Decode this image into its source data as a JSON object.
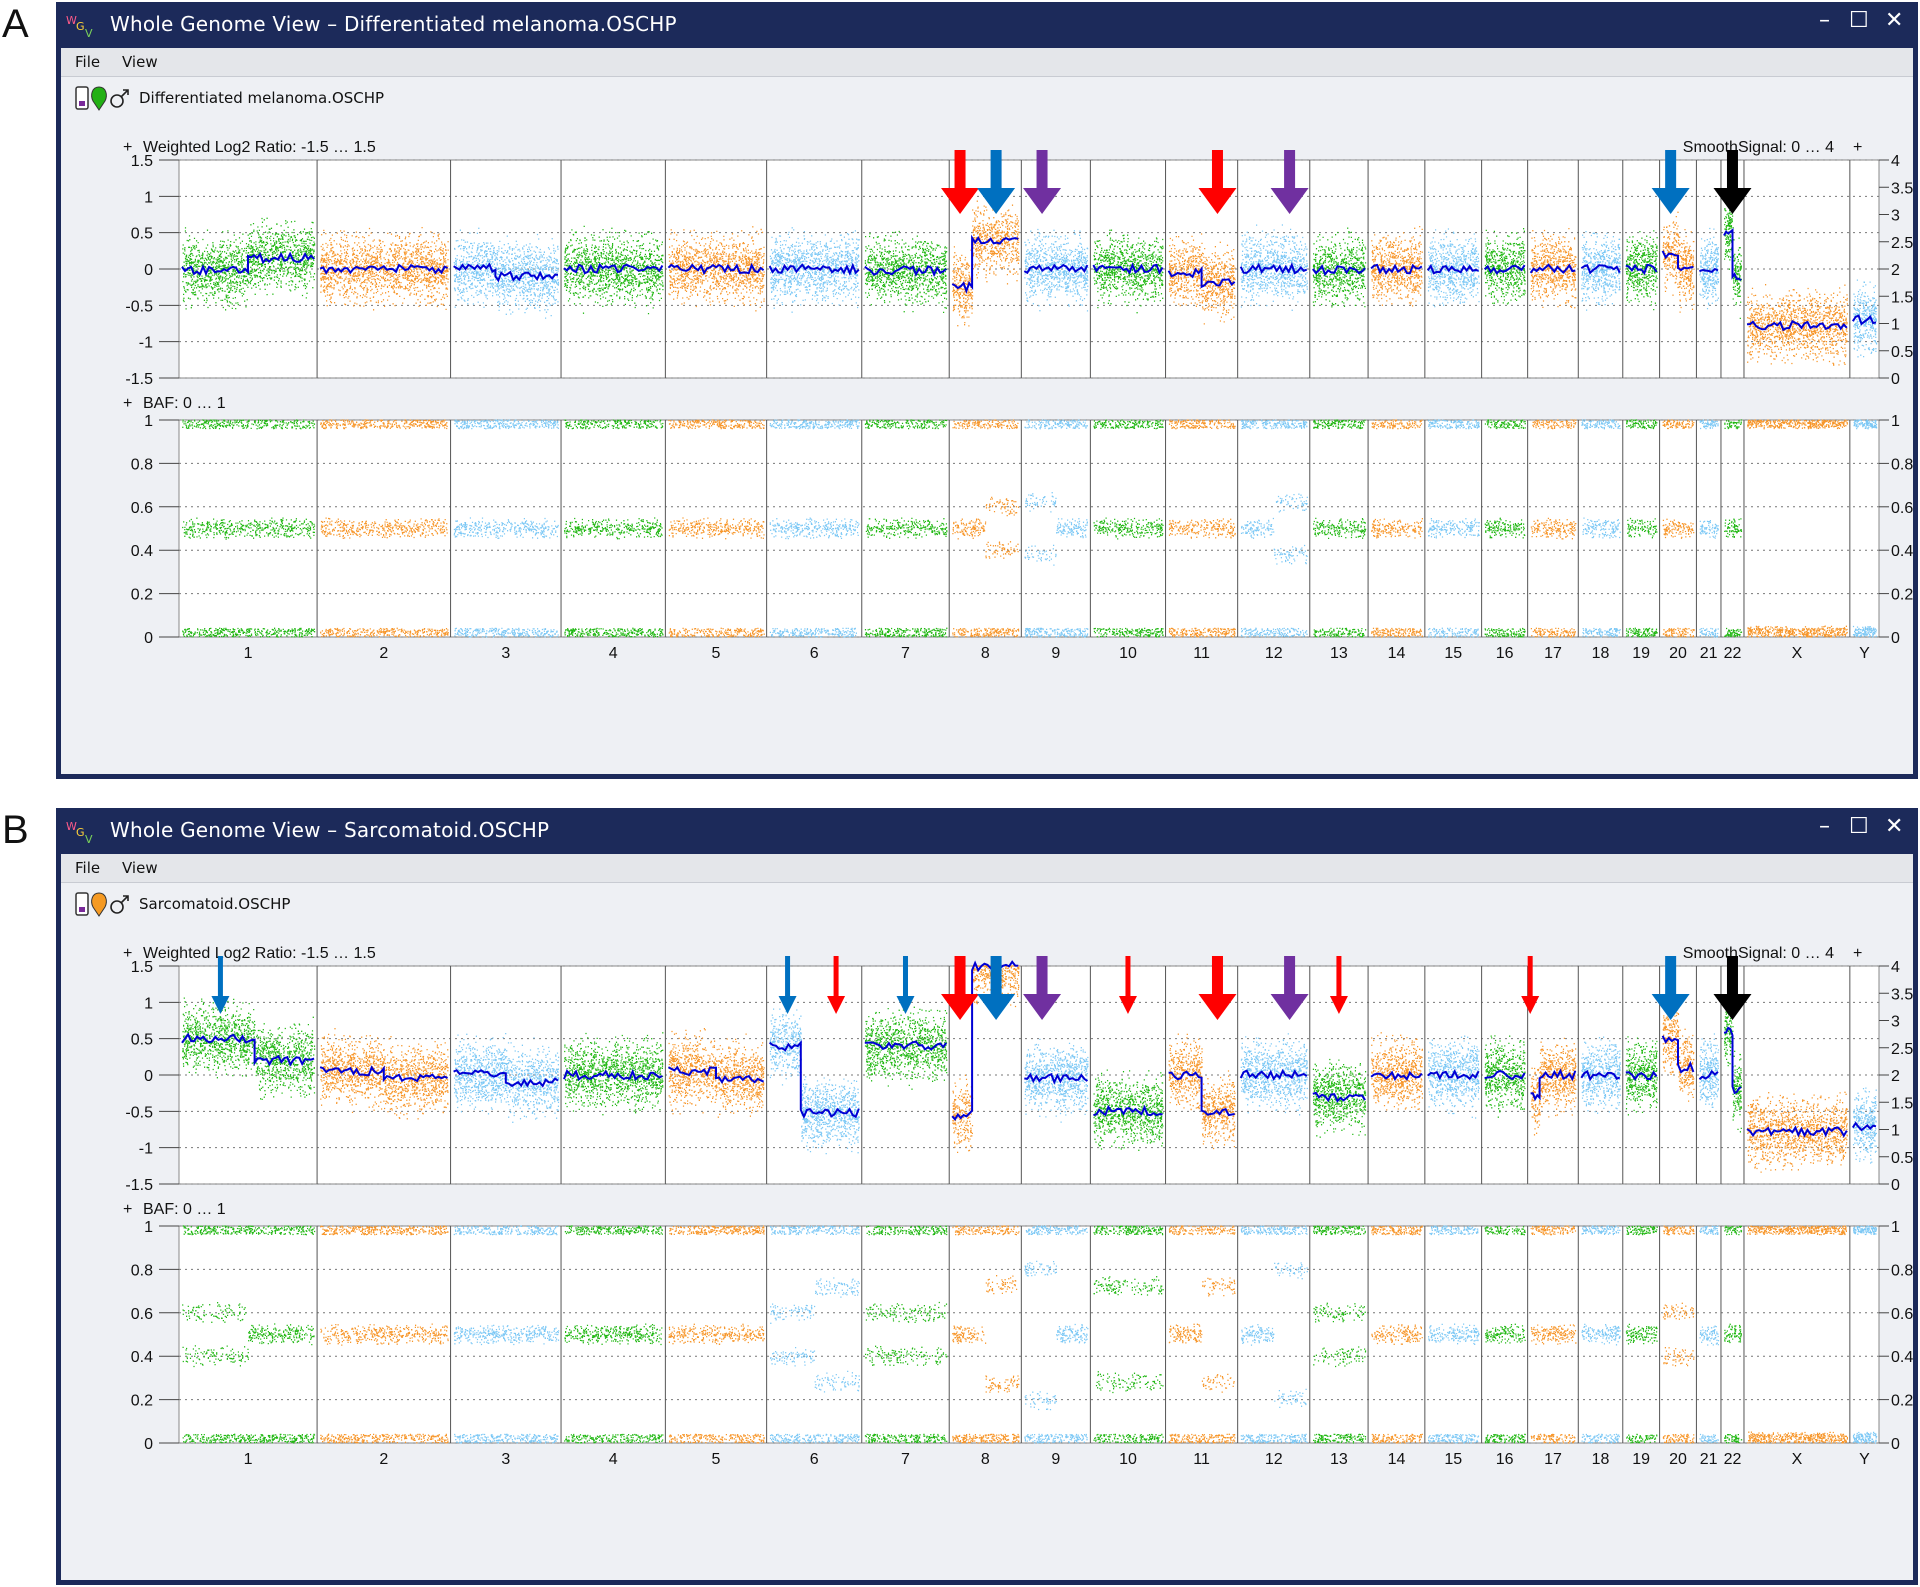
{
  "panels": [
    {
      "letter": "A",
      "title": "Whole Genome View – Differentiated melanoma.OSCHP",
      "menu": [
        "File",
        "View"
      ],
      "sample_name": "Differentiated melanoma.OSCHP",
      "sample_icon_color": "#22b014",
      "copy_label": "Weighted Log2 Ratio: -1.5 … 1.5",
      "smooth_label": "SmoothSignal: 0 … 4",
      "baf_label": "BAF: 0 … 1",
      "lrr_ticks": [
        "1.5",
        "1",
        "0.5",
        "0",
        "-0.5",
        "-1",
        "-1.5"
      ],
      "smooth_ticks": [
        "4",
        "3.5",
        "3",
        "2.5",
        "2",
        "1.5",
        "1",
        "0.5",
        "0"
      ],
      "baf_ticks": [
        "1",
        "0.8",
        "0.6",
        "0.4",
        "0.2",
        "0"
      ],
      "baf_right_ticks": [
        "1",
        "0.8",
        "0.6",
        "0.4",
        "0.2",
        "0"
      ],
      "chromosomes": [
        {
          "label": "1",
          "lrr": [
            [
              0,
              -0.02
            ],
            [
              0.5,
              0.15
            ]
          ],
          "baf": [
            [
              0.5
            ]
          ]
        },
        {
          "label": "2",
          "lrr": [
            [
              0,
              0
            ]
          ],
          "baf": [
            [
              0.5
            ]
          ]
        },
        {
          "label": "3",
          "lrr": [
            [
              0,
              0.02
            ],
            [
              0.4,
              -0.1
            ]
          ],
          "baf": [
            [
              0.5
            ]
          ]
        },
        {
          "label": "4",
          "lrr": [
            [
              0,
              0
            ]
          ],
          "baf": [
            [
              0.5
            ]
          ]
        },
        {
          "label": "5",
          "lrr": [
            [
              0,
              0
            ]
          ],
          "baf": [
            [
              0.5
            ]
          ]
        },
        {
          "label": "6",
          "lrr": [
            [
              0,
              0
            ]
          ],
          "baf": [
            [
              0.5
            ]
          ]
        },
        {
          "label": "7",
          "lrr": [
            [
              0,
              -0.02
            ]
          ],
          "baf": [
            [
              0.5
            ]
          ]
        },
        {
          "label": "8",
          "lrr": [
            [
              0,
              -0.25
            ],
            [
              0.3,
              0.4
            ]
          ],
          "baf": [
            [
              0.5
            ],
            [
              0.4,
              0.6
            ]
          ]
        },
        {
          "label": "9",
          "lrr": [
            [
              0,
              0
            ]
          ],
          "baf": [
            [
              0.38,
              0.62
            ],
            [
              0.5
            ]
          ]
        },
        {
          "label": "10",
          "lrr": [
            [
              0,
              0
            ]
          ],
          "baf": [
            [
              0.5
            ]
          ]
        },
        {
          "label": "11",
          "lrr": [
            [
              0,
              -0.05
            ],
            [
              0.5,
              -0.2
            ]
          ],
          "baf": [
            [
              0.5
            ]
          ]
        },
        {
          "label": "12",
          "lrr": [
            [
              0,
              0
            ]
          ],
          "baf": [
            [
              0.5
            ],
            [
              0.38,
              0.62
            ]
          ]
        },
        {
          "label": "13",
          "lrr": [
            [
              0,
              -0.02
            ]
          ],
          "baf": [
            [
              0.5
            ]
          ]
        },
        {
          "label": "14",
          "lrr": [
            [
              0,
              0
            ]
          ],
          "baf": [
            [
              0.5
            ]
          ]
        },
        {
          "label": "15",
          "lrr": [
            [
              0,
              0
            ]
          ],
          "baf": [
            [
              0.5
            ]
          ]
        },
        {
          "label": "16",
          "lrr": [
            [
              0,
              0
            ]
          ],
          "baf": [
            [
              0.5
            ]
          ]
        },
        {
          "label": "17",
          "lrr": [
            [
              0,
              0
            ]
          ],
          "baf": [
            [
              0.5
            ]
          ]
        },
        {
          "label": "18",
          "lrr": [
            [
              0,
              0
            ]
          ],
          "baf": [
            [
              0.5
            ]
          ]
        },
        {
          "label": "19",
          "lrr": [
            [
              0,
              0
            ]
          ],
          "baf": [
            [
              0.5
            ]
          ]
        },
        {
          "label": "20",
          "lrr": [
            [
              0,
              0.2
            ],
            [
              0.5,
              0
            ]
          ],
          "baf": [
            [
              0.5
            ]
          ]
        },
        {
          "label": "21",
          "lrr": [
            [
              0,
              0
            ]
          ],
          "baf": [
            [
              0.5
            ]
          ]
        },
        {
          "label": "22",
          "lrr": [
            [
              0,
              0.5
            ],
            [
              0.5,
              -0.1
            ]
          ],
          "baf": [
            [
              0.5
            ]
          ]
        },
        {
          "label": "X",
          "lrr": [
            [
              0,
              -0.78
            ]
          ],
          "baf": [
            []
          ]
        },
        {
          "label": "Y",
          "lrr": [
            [
              0,
              -0.7
            ]
          ],
          "baf": [
            []
          ]
        }
      ],
      "arrows": [
        {
          "chrom": "8",
          "pos": 0.15,
          "color": "#ff0000",
          "size": "large"
        },
        {
          "chrom": "8",
          "pos": 0.65,
          "color": "#0070c0",
          "size": "large"
        },
        {
          "chrom": "9",
          "pos": 0.3,
          "color": "#7030a0",
          "size": "large"
        },
        {
          "chrom": "11",
          "pos": 0.72,
          "color": "#ff0000",
          "size": "large"
        },
        {
          "chrom": "12",
          "pos": 0.72,
          "color": "#7030a0",
          "size": "large"
        },
        {
          "chrom": "20",
          "pos": 0.3,
          "color": "#0070c0",
          "size": "large"
        },
        {
          "chrom": "22",
          "pos": 0.5,
          "color": "#000000",
          "size": "large"
        }
      ]
    },
    {
      "letter": "B",
      "title": "Whole Genome View – Sarcomatoid.OSCHP",
      "menu": [
        "File",
        "View"
      ],
      "sample_name": "Sarcomatoid.OSCHP",
      "sample_icon_color": "#f59a23",
      "copy_label": "Weighted Log2 Ratio: -1.5 … 1.5",
      "smooth_label": "SmoothSignal: 0 … 4",
      "baf_label": "BAF: 0 … 1",
      "lrr_ticks": [
        "1.5",
        "1",
        "0.5",
        "0",
        "-0.5",
        "-1",
        "-1.5"
      ],
      "smooth_ticks": [
        "4",
        "3.5",
        "3",
        "2.5",
        "2",
        "1.5",
        "1",
        "0.5",
        "0"
      ],
      "baf_ticks": [
        "1",
        "0.8",
        "0.6",
        "0.4",
        "0.2",
        "0"
      ],
      "baf_right_ticks": [
        "1",
        "0.8",
        "0.6",
        "0.4",
        "0.2",
        "0"
      ],
      "chromosomes": [
        {
          "label": "1",
          "lrr": [
            [
              0,
              0.5
            ],
            [
              0.55,
              0.2
            ]
          ],
          "baf": [
            [
              0.4,
              0.6
            ],
            [
              0.5
            ]
          ]
        },
        {
          "label": "2",
          "lrr": [
            [
              0,
              0.05
            ],
            [
              0.5,
              -0.05
            ]
          ],
          "baf": [
            [
              0.5
            ]
          ]
        },
        {
          "label": "3",
          "lrr": [
            [
              0,
              0.02
            ],
            [
              0.5,
              -0.1
            ]
          ],
          "baf": [
            [
              0.5
            ]
          ]
        },
        {
          "label": "4",
          "lrr": [
            [
              0,
              0
            ]
          ],
          "baf": [
            [
              0.5
            ]
          ]
        },
        {
          "label": "5",
          "lrr": [
            [
              0,
              0.05
            ],
            [
              0.5,
              -0.05
            ]
          ],
          "baf": [
            [
              0.5
            ]
          ]
        },
        {
          "label": "6",
          "lrr": [
            [
              0,
              0.4
            ],
            [
              0.35,
              -0.52
            ]
          ],
          "baf": [
            [
              0.4,
              0.6
            ],
            [
              0.28,
              0.72
            ]
          ]
        },
        {
          "label": "7",
          "lrr": [
            [
              0,
              0.4
            ]
          ],
          "baf": [
            [
              0.4,
              0.6
            ]
          ]
        },
        {
          "label": "8",
          "lrr": [
            [
              0,
              -0.55
            ],
            [
              0.3,
              1.5
            ]
          ],
          "baf": [
            [
              0.5
            ],
            [
              0.27,
              0.73
            ]
          ]
        },
        {
          "label": "9",
          "lrr": [
            [
              0,
              -0.05
            ]
          ],
          "baf": [
            [
              0.2,
              0.8
            ],
            [
              0.5
            ]
          ]
        },
        {
          "label": "10",
          "lrr": [
            [
              0,
              -0.5
            ]
          ],
          "baf": [
            [
              0.28,
              0.72
            ]
          ]
        },
        {
          "label": "11",
          "lrr": [
            [
              0,
              0
            ],
            [
              0.5,
              -0.5
            ]
          ],
          "baf": [
            [
              0.5
            ],
            [
              0.28,
              0.72
            ]
          ]
        },
        {
          "label": "12",
          "lrr": [
            [
              0,
              0
            ]
          ],
          "baf": [
            [
              0.5
            ],
            [
              0.2,
              0.8
            ]
          ]
        },
        {
          "label": "13",
          "lrr": [
            [
              0,
              -0.3
            ]
          ],
          "baf": [
            [
              0.4,
              0.6
            ]
          ]
        },
        {
          "label": "14",
          "lrr": [
            [
              0,
              0
            ]
          ],
          "baf": [
            [
              0.5
            ]
          ]
        },
        {
          "label": "15",
          "lrr": [
            [
              0,
              0
            ]
          ],
          "baf": [
            [
              0.5
            ]
          ]
        },
        {
          "label": "16",
          "lrr": [
            [
              0,
              0
            ]
          ],
          "baf": [
            [
              0.5
            ]
          ]
        },
        {
          "label": "17",
          "lrr": [
            [
              0,
              -0.3
            ],
            [
              0.2,
              0
            ]
          ],
          "baf": [
            [
              0.5
            ]
          ]
        },
        {
          "label": "18",
          "lrr": [
            [
              0,
              0
            ]
          ],
          "baf": [
            [
              0.5
            ]
          ]
        },
        {
          "label": "19",
          "lrr": [
            [
              0,
              0
            ]
          ],
          "baf": [
            [
              0.5
            ]
          ]
        },
        {
          "label": "20",
          "lrr": [
            [
              0,
              0.5
            ],
            [
              0.5,
              0.1
            ]
          ],
          "baf": [
            [
              0.4,
              0.6
            ]
          ]
        },
        {
          "label": "21",
          "lrr": [
            [
              0,
              0
            ]
          ],
          "baf": [
            [
              0.5
            ]
          ]
        },
        {
          "label": "22",
          "lrr": [
            [
              0,
              0.6
            ],
            [
              0.5,
              -0.2
            ]
          ],
          "baf": [
            [
              0.5
            ]
          ]
        },
        {
          "label": "X",
          "lrr": [
            [
              0,
              -0.78
            ]
          ],
          "baf": [
            []
          ]
        },
        {
          "label": "Y",
          "lrr": [
            [
              0,
              -0.7
            ]
          ],
          "baf": [
            []
          ]
        }
      ],
      "arrows": [
        {
          "chrom": "1",
          "pos": 0.3,
          "color": "#0070c0",
          "size": "small"
        },
        {
          "chrom": "6",
          "pos": 0.22,
          "color": "#0070c0",
          "size": "small"
        },
        {
          "chrom": "6",
          "pos": 0.73,
          "color": "#ff0000",
          "size": "small"
        },
        {
          "chrom": "7",
          "pos": 0.5,
          "color": "#0070c0",
          "size": "small"
        },
        {
          "chrom": "8",
          "pos": 0.15,
          "color": "#ff0000",
          "size": "large"
        },
        {
          "chrom": "8",
          "pos": 0.65,
          "color": "#0070c0",
          "size": "large"
        },
        {
          "chrom": "9",
          "pos": 0.3,
          "color": "#7030a0",
          "size": "large"
        },
        {
          "chrom": "10",
          "pos": 0.5,
          "color": "#ff0000",
          "size": "small"
        },
        {
          "chrom": "11",
          "pos": 0.72,
          "color": "#ff0000",
          "size": "large"
        },
        {
          "chrom": "12",
          "pos": 0.72,
          "color": "#7030a0",
          "size": "large"
        },
        {
          "chrom": "13",
          "pos": 0.5,
          "color": "#ff0000",
          "size": "small"
        },
        {
          "chrom": "17",
          "pos": 0.05,
          "color": "#ff0000",
          "size": "small"
        },
        {
          "chrom": "20",
          "pos": 0.3,
          "color": "#0070c0",
          "size": "large"
        },
        {
          "chrom": "22",
          "pos": 0.5,
          "color": "#000000",
          "size": "large"
        }
      ]
    }
  ],
  "colors": {
    "green": "#22b814",
    "orange": "#f7962a",
    "blue": "#7cc8f5",
    "smooth_line": "#0000d4",
    "title_bar": "#1c2a5a"
  }
}
